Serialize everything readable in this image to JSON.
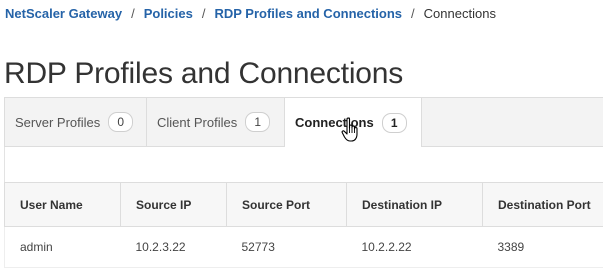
{
  "breadcrumb": {
    "items": [
      "NetScaler Gateway",
      "Policies",
      "RDP Profiles and Connections"
    ],
    "current": "Connections",
    "separator": "/"
  },
  "page_title": "RDP Profiles and Connections",
  "tabs": [
    {
      "label": "Server Profiles",
      "count": "0",
      "active": false
    },
    {
      "label": "Client Profiles",
      "count": "1",
      "active": false
    },
    {
      "label": "Connections",
      "count": "1",
      "active": true
    }
  ],
  "table": {
    "columns": [
      "User Name",
      "Source IP",
      "Source Port",
      "Destination IP",
      "Destination Port"
    ],
    "rows": [
      [
        "admin",
        "10.2.3.22",
        "52773",
        "10.2.2.22",
        "3389"
      ]
    ]
  },
  "colors": {
    "link": "#2563a8",
    "text": "#333333",
    "tab_bg": "#f3f3f3",
    "border": "#dddddd"
  },
  "icons": {
    "cursor": "hand-pointer-cursor-icon"
  }
}
